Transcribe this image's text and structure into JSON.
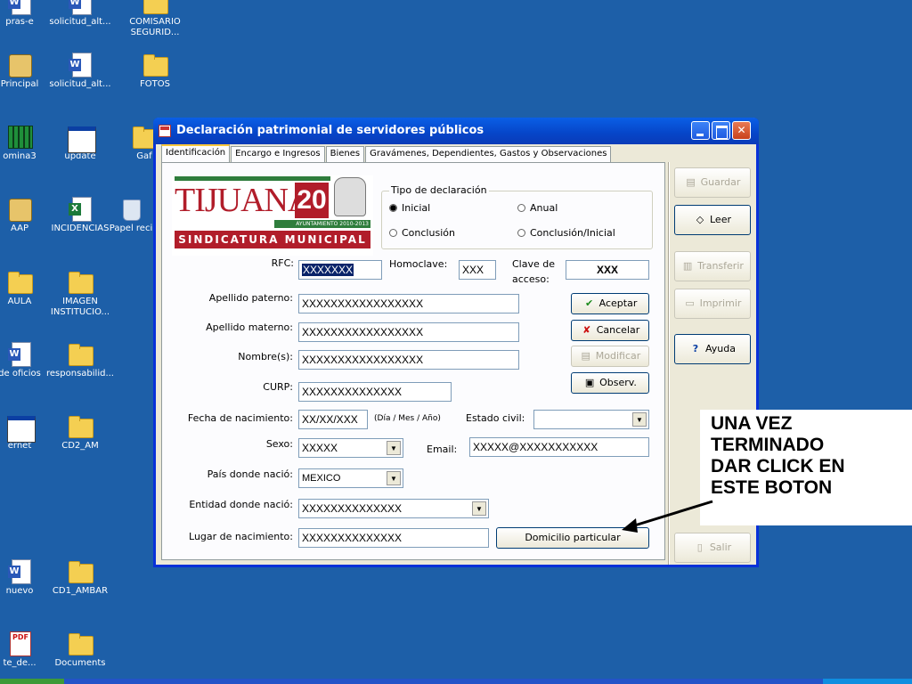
{
  "desktop": {
    "icons": [
      {
        "label": "pras-e",
        "icon": "document-icon"
      },
      {
        "label": "solicitud_alt...",
        "icon": "document-icon"
      },
      {
        "label": "COMISARIO SEGURID...",
        "icon": "folder-icon"
      },
      {
        "label": "Principal",
        "icon": "app-icon"
      },
      {
        "label": "solicitud_alt...",
        "icon": "word-document-icon"
      },
      {
        "label": "FOTOS",
        "icon": "folder-icon"
      },
      {
        "label": "omina3",
        "icon": "spreadsheet-app-icon"
      },
      {
        "label": "update",
        "icon": "window-icon"
      },
      {
        "label": "Gaf",
        "icon": "folder-icon"
      },
      {
        "label": "AAP",
        "icon": "app-icon"
      },
      {
        "label": "INCIDENCIAS",
        "icon": "excel-document-icon"
      },
      {
        "label": "Papel reci",
        "icon": "recycle-bin-icon"
      },
      {
        "label": "AULA",
        "icon": "folder-icon"
      },
      {
        "label": "IMAGEN INSTITUCIO...",
        "icon": "folder-icon"
      },
      {
        "label": "de oficios",
        "icon": "word-document-icon"
      },
      {
        "label": "responsabilid...",
        "icon": "folder-icon"
      },
      {
        "label": "ernet",
        "icon": "window-icon"
      },
      {
        "label": "CD2_AM",
        "icon": "folder-icon"
      },
      {
        "label": "nuevo",
        "icon": "word-document-icon"
      },
      {
        "label": "CD1_AMBAR",
        "icon": "folder-icon"
      },
      {
        "label": "te_de...",
        "icon": "pdf-document-icon"
      },
      {
        "label": "Documents",
        "icon": "folder-icon"
      }
    ]
  },
  "window": {
    "title": "Declaración patrimonial de servidores públicos",
    "tabs": [
      {
        "label": "Identificación",
        "active": true
      },
      {
        "label": "Encargo e Ingresos",
        "active": false
      },
      {
        "label": "Bienes",
        "active": false
      },
      {
        "label": "Gravámenes, Dependientes, Gastos y Observaciones",
        "active": false
      }
    ]
  },
  "logo": {
    "word": "TIJUANA",
    "number": "20",
    "ayuntamiento": "AYUNTAMIENTO 2010-2013",
    "sindicatura": "SINDICATURA MUNICIPAL"
  },
  "tipo_declaracion": {
    "legend": "Tipo de declaración",
    "options": [
      {
        "label": "Inicial",
        "selected": true
      },
      {
        "label": "Anual",
        "selected": false
      },
      {
        "label": "Conclusión",
        "selected": false
      },
      {
        "label": "Conclusión/Inicial",
        "selected": false
      }
    ]
  },
  "form": {
    "rfc": {
      "label": "RFC:",
      "value": "XXXXXXX"
    },
    "homoclave": {
      "label": "Homoclave:",
      "value": "XXX"
    },
    "clave": {
      "label_1": "Clave de",
      "label_2": "acceso:",
      "value": "XXX"
    },
    "apellido_paterno": {
      "label": "Apellido paterno:",
      "value": "XXXXXXXXXXXXXXXXX"
    },
    "apellido_materno": {
      "label": "Apellido materno:",
      "value": "XXXXXXXXXXXXXXXXX"
    },
    "nombre": {
      "label": "Nombre(s):",
      "value": "XXXXXXXXXXXXXXXXX"
    },
    "curp": {
      "label": "CURP:",
      "value": "XXXXXXXXXXXXXX"
    },
    "fecha": {
      "label": "Fecha de nacimiento:",
      "value": "XX/XX/XXX",
      "hint": "(Día / Mes / Año)"
    },
    "estado_civil": {
      "label": "Estado civil:",
      "value": ""
    },
    "sexo": {
      "label": "Sexo:",
      "value": "XXXXX"
    },
    "email": {
      "label": "Email:",
      "value": "XXXXX@XXXXXXXXXXX"
    },
    "pais": {
      "label": "País donde nació:",
      "value": "MEXICO"
    },
    "entidad": {
      "label": "Entidad donde nació:",
      "value": "XXXXXXXXXXXXXX"
    },
    "lugar": {
      "label": "Lugar de nacimiento:",
      "value": "XXXXXXXXXXXXXX"
    }
  },
  "inner_buttons": {
    "aceptar": "Aceptar",
    "cancelar": "Cancelar",
    "modificar": "Modificar",
    "observ": "Observ.",
    "domicilio": "Domicilio particular"
  },
  "side_buttons": {
    "guardar": "Guardar",
    "leer": "Leer",
    "transferir": "Transferir",
    "imprimir": "Imprimir",
    "ayuda": "Ayuda",
    "salir": "Salir"
  },
  "annotation": {
    "line1": "UNA VEZ",
    "line2": "TERMINADO",
    "line3": "DAR CLICK EN",
    "line4": "ESTE BOTON"
  },
  "colors": {
    "desktop": "#1d5fa8",
    "titlebar": "#0645c8",
    "brand_red": "#b11d2a",
    "brand_green": "#2f7d3c"
  }
}
